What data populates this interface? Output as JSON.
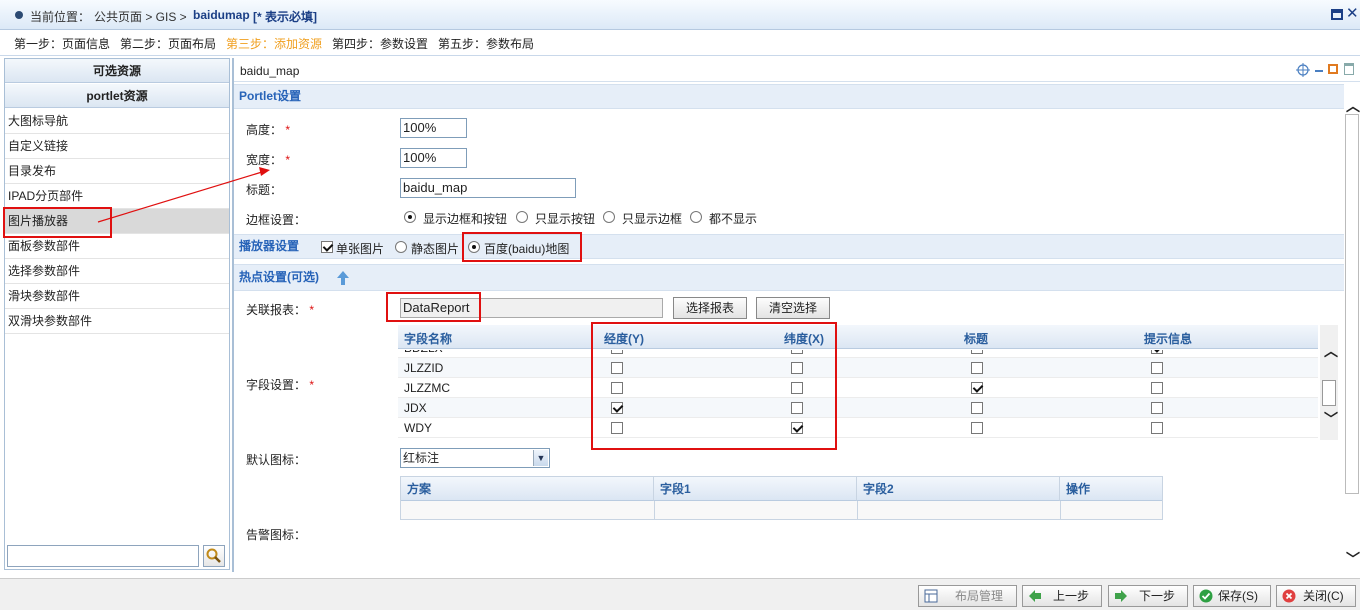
{
  "titlebar": {
    "location_label": "当前位置：",
    "crumbs": "公共页面 > GIS >",
    "page": "baidumap",
    "required_note": "[* 表示必填]"
  },
  "steps": [
    {
      "label": "第一步：页面信息",
      "active": false
    },
    {
      "label": "第二步：页面布局",
      "active": false
    },
    {
      "label": "第三步：添加资源",
      "active": true
    },
    {
      "label": "第四步：参数设置",
      "active": false
    },
    {
      "label": "第五步：参数布局",
      "active": false
    }
  ],
  "sidebar": {
    "header1": "可选资源",
    "header2": "portlet资源",
    "items": [
      "大图标导航",
      "自定义链接",
      "目录发布",
      "IPAD分页部件",
      "图片播放器",
      "面板参数部件",
      "选择参数部件",
      "滑块参数部件",
      "双滑块参数部件"
    ],
    "selected": "图片播放器",
    "search_value": ""
  },
  "panel": {
    "title": "baidu_map",
    "portlet_section": "Portlet设置",
    "height_label": "高度：",
    "height_value": "100%",
    "width_label": "宽度：",
    "width_value": "100%",
    "title_label": "标题：",
    "title_value": "baidu_map",
    "border_label": "边框设置：",
    "border_options": [
      "显示边框和按钮",
      "只显示按钮",
      "只显示边框",
      "都不显示"
    ],
    "border_selected": "显示边框和按钮",
    "player_section": "播放器设置",
    "player_single": "单张图片",
    "player_single_checked": true,
    "player_static": "静态图片",
    "player_baidu": "百度(baidu)地图",
    "player_selected": "百度(baidu)地图",
    "hotspot_section": "热点设置(可选)",
    "report_label": "关联报表：",
    "report_value": "DataReport",
    "select_report_btn": "选择报表",
    "clear_select_btn": "清空选择",
    "field_label": "字段设置：",
    "field_headers": [
      "字段名称",
      "经度(Y)",
      "纬度(X)",
      "标题",
      "提示信息"
    ],
    "field_rows": [
      {
        "name": "BDZLX",
        "lng": false,
        "lat": false,
        "title": false,
        "tip": true
      },
      {
        "name": "JLZZID",
        "lng": false,
        "lat": false,
        "title": false,
        "tip": false
      },
      {
        "name": "JLZZMC",
        "lng": false,
        "lat": false,
        "title": true,
        "tip": false
      },
      {
        "name": "JDX",
        "lng": true,
        "lat": false,
        "title": false,
        "tip": false
      },
      {
        "name": "WDY",
        "lng": false,
        "lat": true,
        "title": false,
        "tip": false
      }
    ],
    "default_icon_label": "默认图标：",
    "default_icon_value": "红标注",
    "alarm_headers": [
      "方案",
      "字段1",
      "字段2",
      "操作"
    ],
    "alarm_label": "告警图标："
  },
  "bottom": {
    "layout_btn": "布局管理",
    "prev_btn": "上一步",
    "next_btn": "下一步",
    "save_btn": "保存(S)",
    "close_btn": "关闭(C)"
  },
  "colors": {
    "accent_step": "#f0a020",
    "section_text": "#2763b8",
    "annotation": "#e01010"
  }
}
